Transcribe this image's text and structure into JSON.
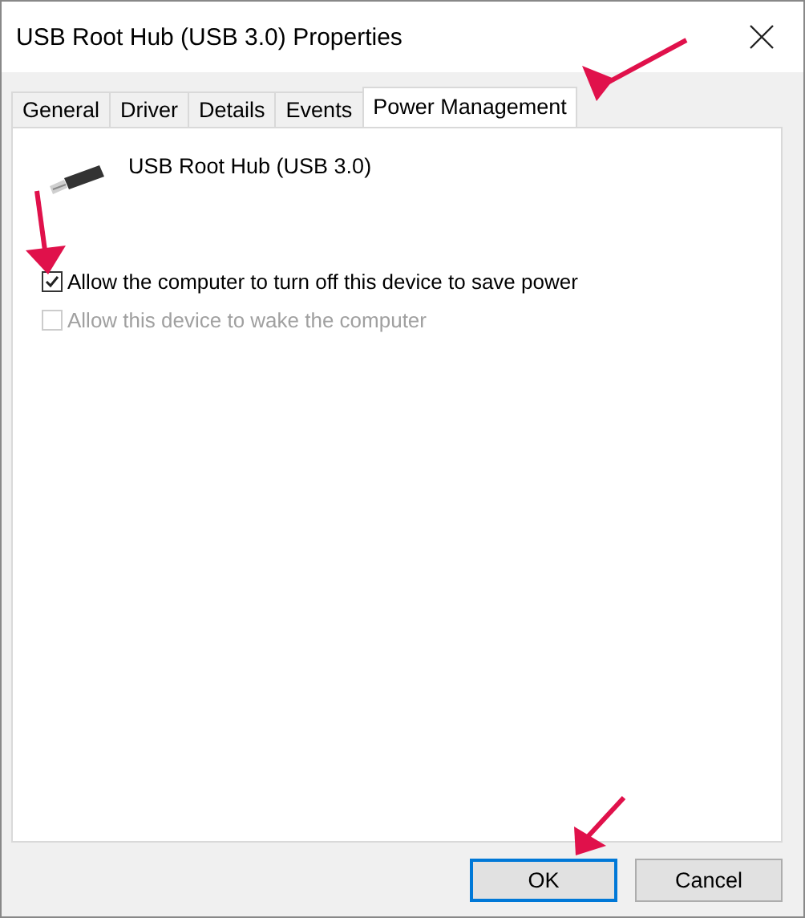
{
  "window": {
    "title": "USB Root Hub (USB 3.0) Properties"
  },
  "tabs": [
    {
      "label": "General",
      "selected": false
    },
    {
      "label": "Driver",
      "selected": false
    },
    {
      "label": "Details",
      "selected": false
    },
    {
      "label": "Events",
      "selected": false
    },
    {
      "label": "Power Management",
      "selected": true
    }
  ],
  "device": {
    "name": "USB Root Hub (USB 3.0)"
  },
  "options": [
    {
      "label": "Allow the computer to turn off this device to save power",
      "checked": true,
      "disabled": false
    },
    {
      "label": "Allow this device to wake the computer",
      "checked": false,
      "disabled": true
    }
  ],
  "buttons": [
    {
      "label": "OK",
      "default": true
    },
    {
      "label": "Cancel",
      "default": false
    }
  ]
}
